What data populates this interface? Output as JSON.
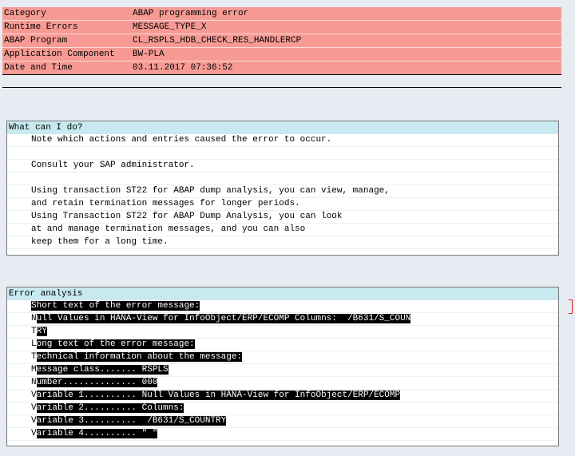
{
  "header": {
    "rows": [
      {
        "key": "Category",
        "value": "ABAP programming error"
      },
      {
        "key": "Runtime Errors",
        "value": "MESSAGE_TYPE_X"
      },
      {
        "key": "ABAP Program",
        "value": "CL_RSPLS_HDB_CHECK_RES_HANDLERCP"
      },
      {
        "key": "Application Component",
        "value": "BW-PLA"
      },
      {
        "key": "Date and Time",
        "value": "03.11.2017 07:36:52"
      }
    ]
  },
  "what_can_i_do": {
    "title": "What can I do?",
    "lines": [
      "Note which actions and entries caused the error to occur.",
      "",
      "Consult your SAP administrator.",
      "",
      "Using transaction ST22 for ABAP dump analysis, you can view, manage,",
      "and retain termination messages for longer periods.",
      "Using Transaction ST22 for ABAP Dump Analysis, you can look",
      "at and manage termination messages, and you can also",
      "keep them for a long time."
    ]
  },
  "error_analysis": {
    "title": "Error analysis",
    "lines": [
      {
        "first": "S",
        "rest": "hort text of the error message:"
      },
      {
        "first": "N",
        "rest": "ull Values in HANA-View for InfoObject/ERP/ECOMP Columns:  /B631/S_COUN"
      },
      {
        "first": "T",
        "rest": "RY"
      },
      {
        "first": "L",
        "rest": "ong text of the error message:"
      },
      {
        "first": "T",
        "rest": "echnical information about the message:"
      },
      {
        "first": "M",
        "rest": "essage class....... RSPLS"
      },
      {
        "first": "N",
        "rest": "umber.............. 000"
      },
      {
        "first": "V",
        "rest": "ariable 1.......... Null Values in HANA-View for InfoObject/ERP/ECOMP"
      },
      {
        "first": "V",
        "rest": "ariable 2.......... Columns:"
      },
      {
        "first": "V",
        "rest": "ariable 3..........  /B631/S_COUNTRY"
      },
      {
        "first": "V",
        "rest": "ariable 4.......... \" \""
      }
    ]
  }
}
